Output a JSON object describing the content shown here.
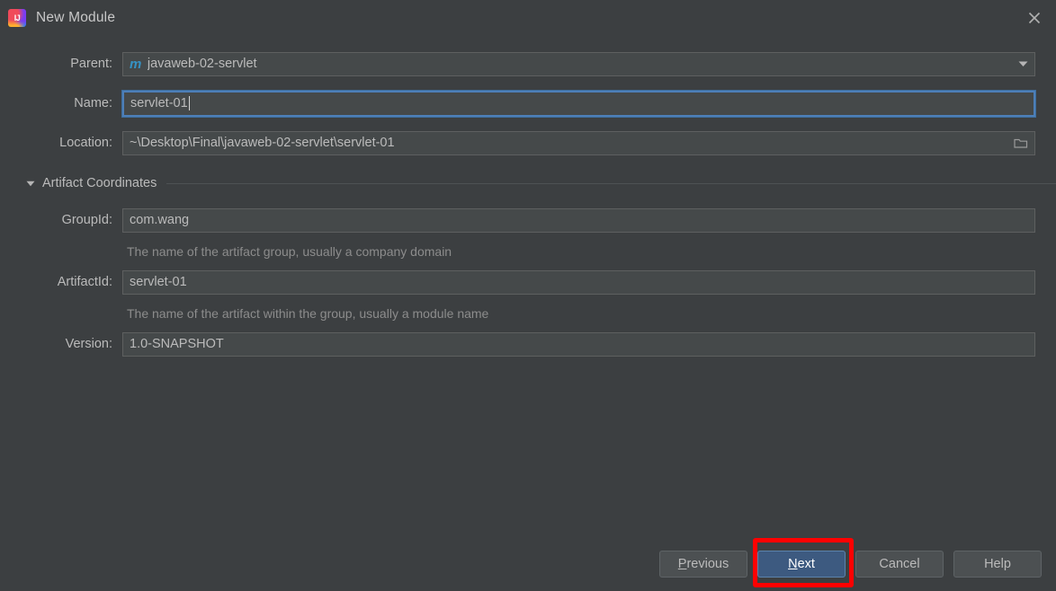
{
  "window": {
    "title": "New Module",
    "app_icon": "intellij-idea-logo",
    "close_icon": "close-icon"
  },
  "colors": {
    "background": "#3c3f41",
    "field_background": "#45494a",
    "focus_border": "#4d7fb8",
    "default_button": "#3d5a80",
    "annotation": "#ff0000",
    "maven_icon": "#3592c4",
    "hint_text": "#8c8c8c"
  },
  "form": {
    "parent": {
      "label": "Parent:",
      "icon": "maven-module-icon",
      "icon_text": "m",
      "value": "javaweb-02-servlet",
      "dropdown_icon": "chevron-down-icon"
    },
    "name": {
      "label": "Name:",
      "value": "servlet-01",
      "focused": true
    },
    "location": {
      "label": "Location:",
      "value": "~\\Desktop\\Final\\javaweb-02-servlet\\servlet-01",
      "browse_icon": "folder-icon"
    }
  },
  "artifact_coordinates": {
    "section_title": "Artifact Coordinates",
    "collapse_icon": "triangle-down-icon",
    "group_id": {
      "label": "GroupId:",
      "value": "com.wang",
      "hint": "The name of the artifact group, usually a company domain"
    },
    "artifact_id": {
      "label": "ArtifactId:",
      "value": "servlet-01",
      "hint": "The name of the artifact within the group, usually a module name"
    },
    "version": {
      "label": "Version:",
      "value": "1.0-SNAPSHOT"
    }
  },
  "buttons": {
    "previous": {
      "mnemonic": "P",
      "rest": "revious"
    },
    "next": {
      "mnemonic": "N",
      "rest": "ext"
    },
    "cancel": {
      "label": "Cancel"
    },
    "help": {
      "label": "Help"
    }
  }
}
